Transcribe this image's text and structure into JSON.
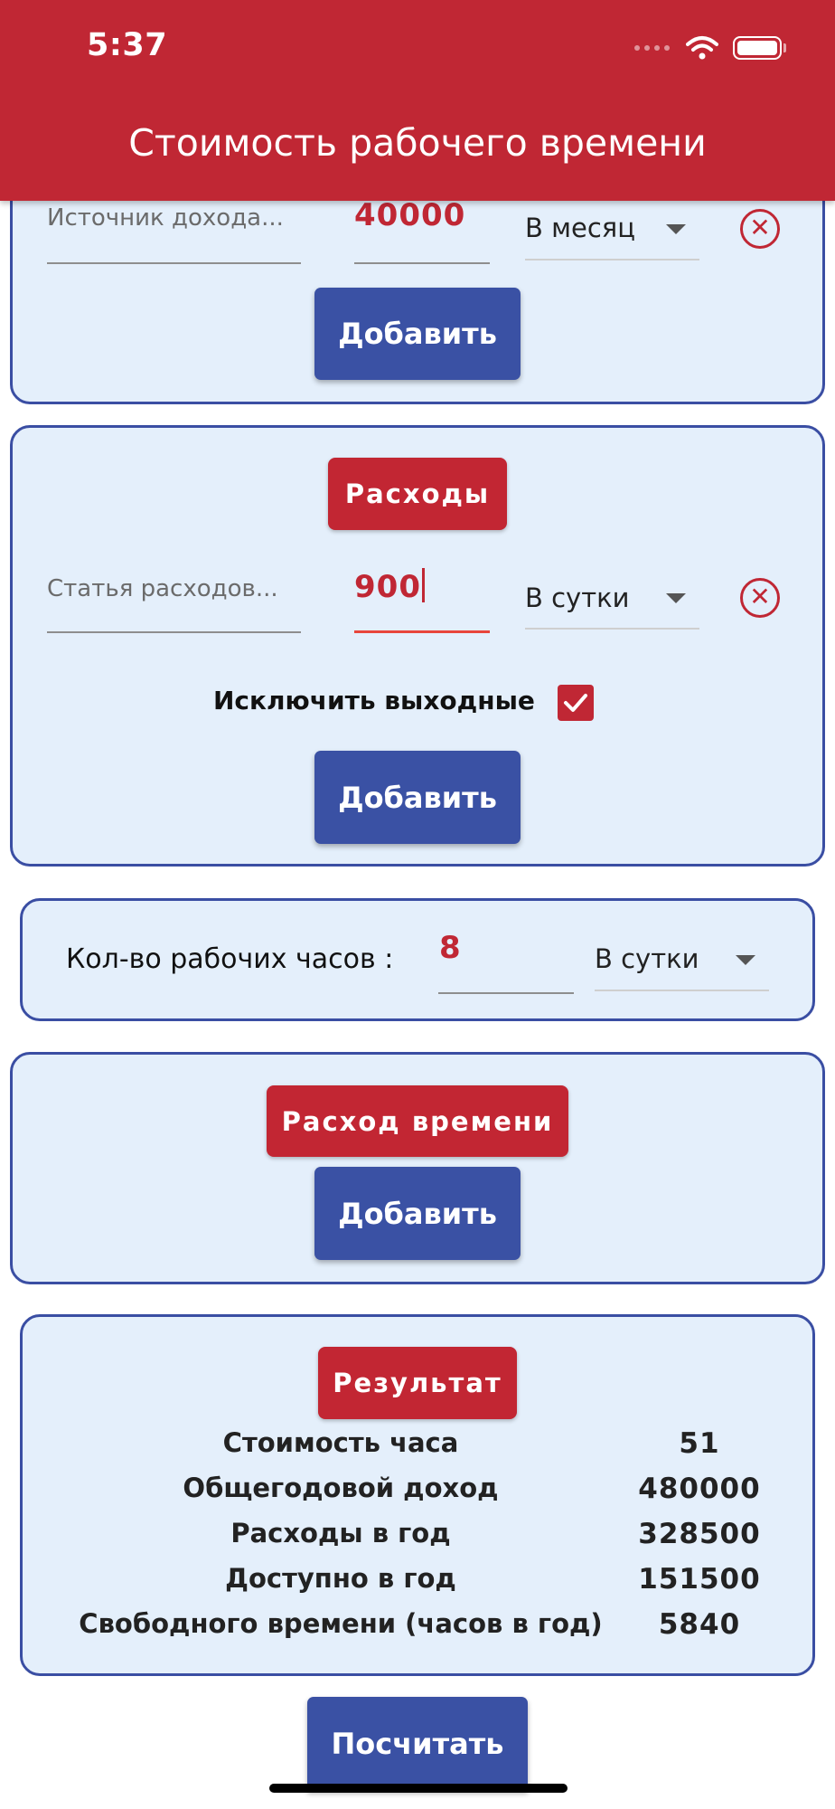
{
  "status_bar": {
    "time": "5:37"
  },
  "header": {
    "title": "Стоимость рабочего времени"
  },
  "income": {
    "source_placeholder": "Источник дохода...",
    "amount": "40000",
    "period": "В месяц",
    "add_label": "Добавить"
  },
  "expenses": {
    "title": "Расходы",
    "item_placeholder": "Статья расходов...",
    "amount": "900",
    "period": "В сутки",
    "exclude_weekends_label": "Исключить выходные",
    "exclude_weekends_checked": true,
    "add_label": "Добавить"
  },
  "work_hours": {
    "label": "Кол-во рабочих часов :",
    "value": "8",
    "period": "В сутки"
  },
  "time_spend": {
    "title": "Расход времени",
    "add_label": "Добавить"
  },
  "result": {
    "title": "Результат",
    "rows": [
      {
        "label": "Стоимость часа",
        "value": "51"
      },
      {
        "label": "Общегодовой доход",
        "value": "480000"
      },
      {
        "label": "Расходы в год",
        "value": "328500"
      },
      {
        "label": "Доступно в год",
        "value": "151500"
      },
      {
        "label": "Свободного времени (часов в год)",
        "value": "5840"
      }
    ]
  },
  "calculate_label": "Посчитать",
  "colors": {
    "header": "#c02734",
    "accent_red": "#c22633",
    "button_blue": "#3a51a4",
    "card_bg": "#e4effb",
    "card_border": "#3a4ea3"
  },
  "icons": {
    "remove": "x-circle-icon",
    "dropdown": "triangle-down-icon",
    "checkbox": "checkmark-icon",
    "wifi": "wifi-icon",
    "battery": "battery-icon"
  }
}
